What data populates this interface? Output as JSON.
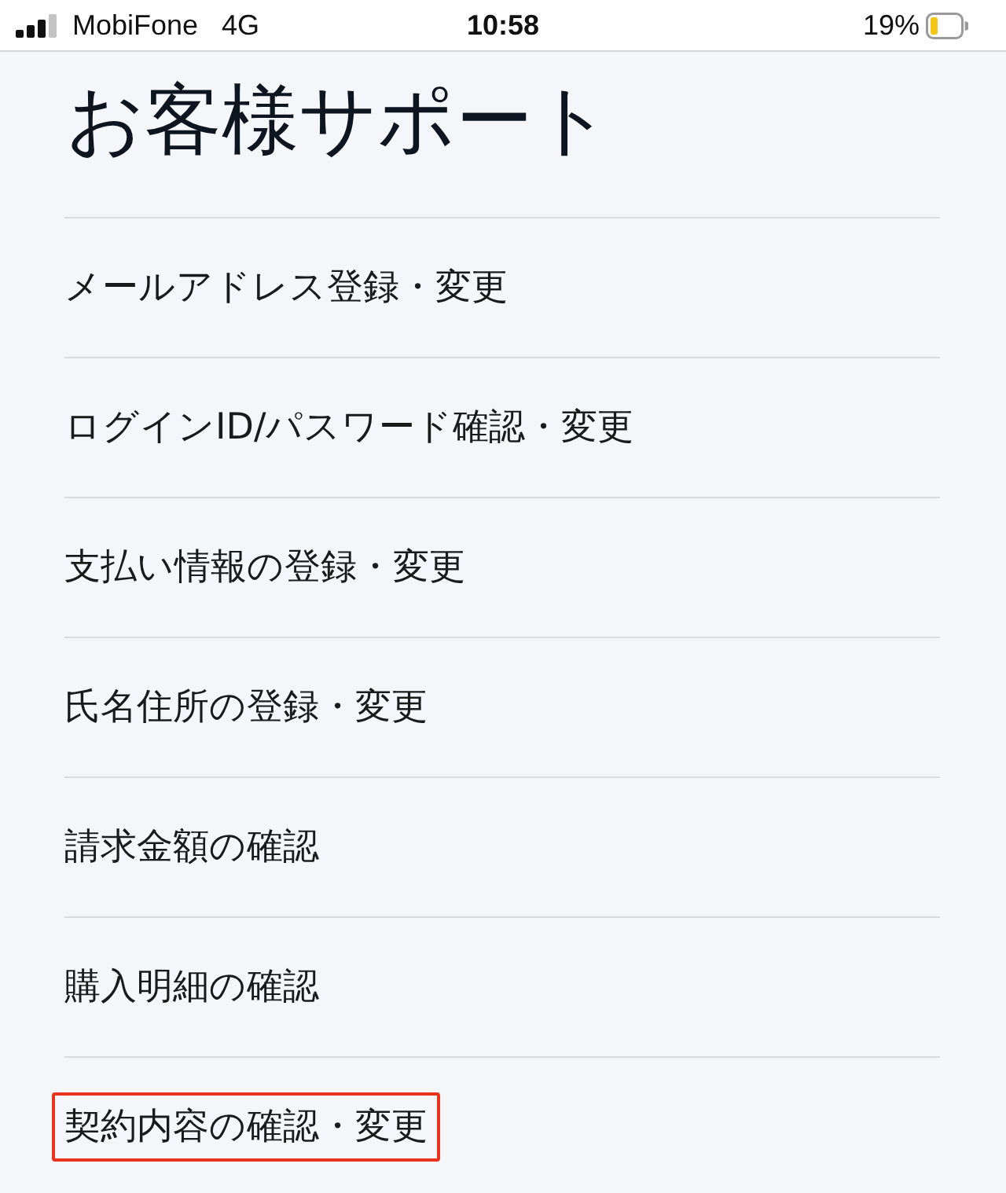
{
  "status_bar": {
    "carrier": "MobiFone",
    "network": "4G",
    "time": "10:58",
    "battery_percent": "19%"
  },
  "title": "お客様サポート",
  "menu_items": [
    {
      "label": "メールアドレス登録・変更",
      "highlighted": false
    },
    {
      "label": "ログインID/パスワード確認・変更",
      "highlighted": false
    },
    {
      "label": "支払い情報の登録・変更",
      "highlighted": false
    },
    {
      "label": "氏名住所の登録・変更",
      "highlighted": false
    },
    {
      "label": "請求金額の確認",
      "highlighted": false
    },
    {
      "label": "購入明細の確認",
      "highlighted": false
    },
    {
      "label": "契約内容の確認・変更",
      "highlighted": true
    }
  ]
}
